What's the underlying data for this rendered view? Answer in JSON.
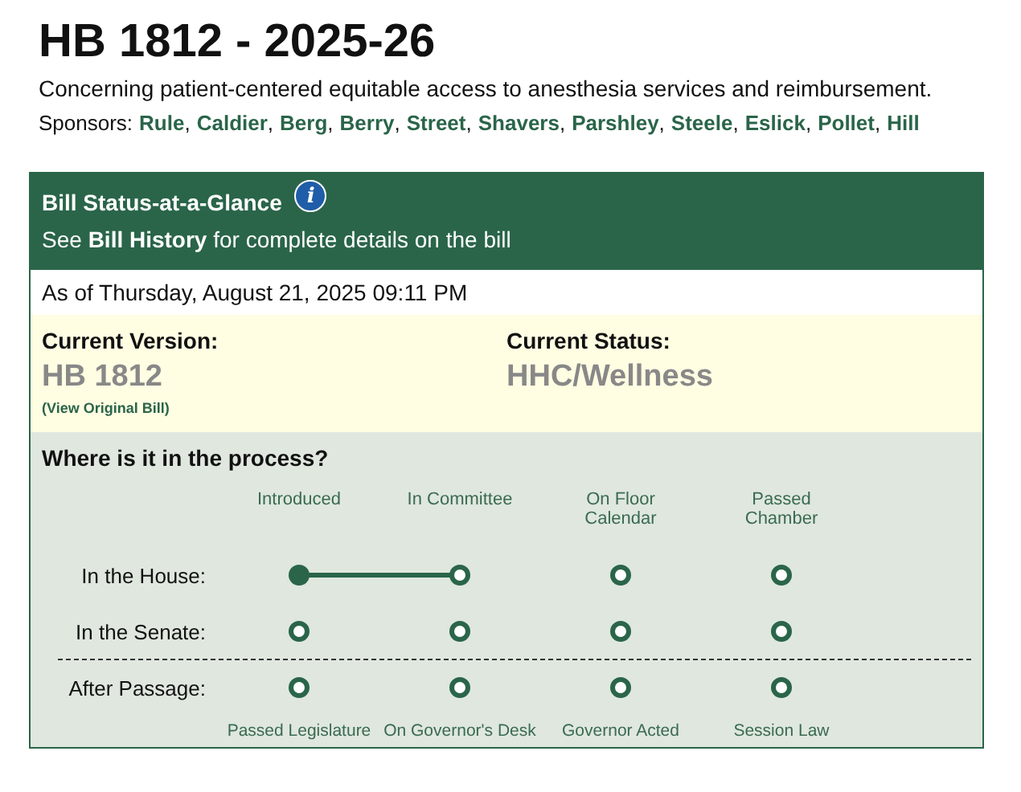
{
  "title": "HB 1812 - 2025-26",
  "description": "Concerning patient-centered equitable access to anesthesia services and reimbursement.",
  "sponsors": {
    "label": "Sponsors:",
    "separator": ",",
    "names": [
      "Rule",
      "Caldier",
      "Berg",
      "Berry",
      "Street",
      "Shavers",
      "Parshley",
      "Steele",
      "Eslick",
      "Pollet",
      "Hill"
    ]
  },
  "status_panel": {
    "title": "Bill Status-at-a-Glance",
    "info_icon": "i",
    "subtitle": "See **Bill History** for complete details on the bill",
    "as_of": "As of Thursday, August 21, 2025 09:11 PM",
    "current_version": {
      "label": "Current Version:",
      "value": "HB 1812",
      "link": "(View Original Bill)"
    },
    "current_status": {
      "label": "Current Status:",
      "value": "HHC/Wellness"
    },
    "process": {
      "title": "Where is it in the process?",
      "top_labels": [
        "Introduced",
        "In Committee",
        "On Floor Calendar",
        "Passed Chamber"
      ],
      "chamber_rows": [
        {
          "label": "In the House:",
          "stages": [
            {
              "filled": true
            },
            {
              "filled": false
            },
            {
              "filled": false
            },
            {
              "filled": false
            }
          ],
          "segments": [
            {
              "on": true
            },
            {
              "on": false
            },
            {
              "on": false
            }
          ]
        },
        {
          "label": "In the Senate:",
          "stages": [
            {
              "filled": false
            },
            {
              "filled": false
            },
            {
              "filled": false
            },
            {
              "filled": false
            }
          ],
          "segments": [
            {
              "on": false
            },
            {
              "on": false
            },
            {
              "on": false
            }
          ]
        }
      ],
      "after_passage_row": {
        "label": "After Passage:",
        "stages": [
          {
            "filled": false
          },
          {
            "filled": false
          },
          {
            "filled": false
          },
          {
            "filled": false
          }
        ],
        "segments": [
          {
            "on": false
          },
          {
            "on": false
          },
          {
            "on": false
          }
        ]
      },
      "bottom_labels": [
        "Passed Legislature",
        "On Governor's Desk",
        "Governor Acted",
        "Session Law"
      ]
    }
  }
}
